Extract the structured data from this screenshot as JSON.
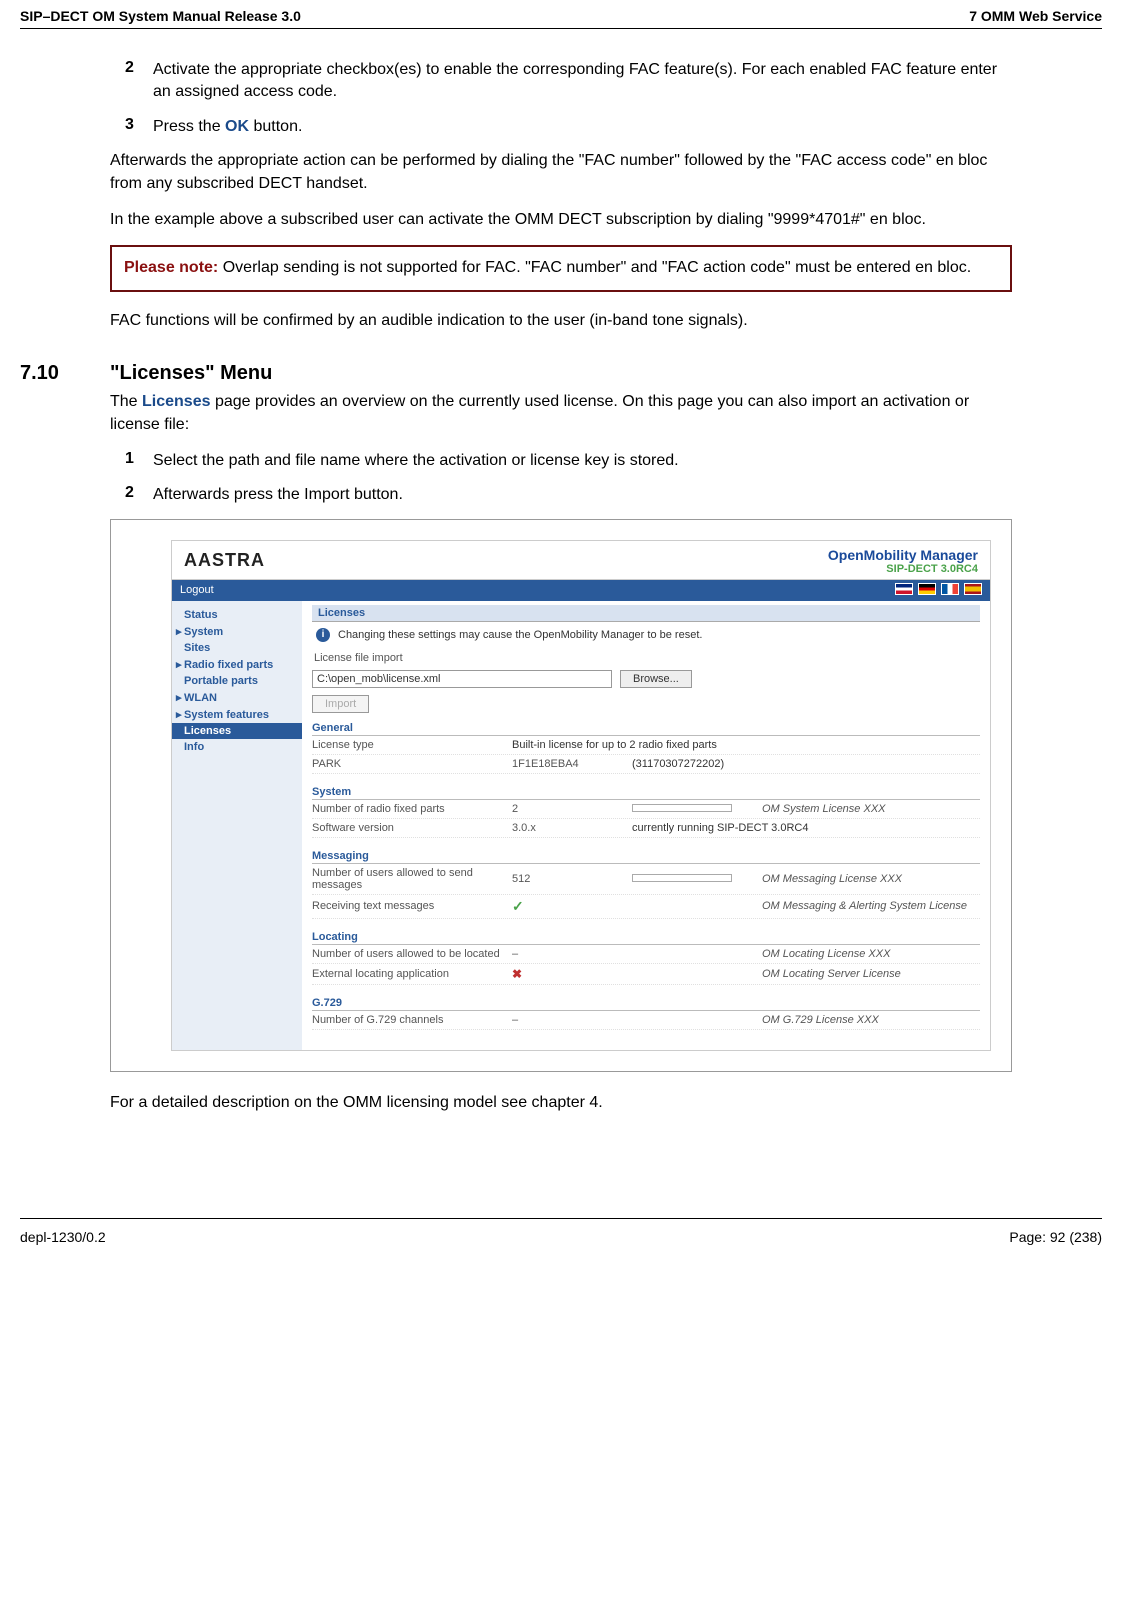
{
  "header": {
    "left": "SIP–DECT OM System Manual Release 3.0",
    "right": "7 OMM Web Service"
  },
  "body": {
    "item2_num": "2",
    "item2": "Activate the appropriate checkbox(es) to enable the corresponding FAC feature(s). For each enabled FAC feature enter an assigned access code.",
    "item3_num": "3",
    "item3_pre": "Press the ",
    "item3_ok": "OK",
    "item3_post": " button.",
    "para_afterwards": "Afterwards the appropriate action can be performed by dialing the \"FAC number\" followed by the \"FAC access code\" en bloc from any subscribed DECT handset.",
    "para_example": "In the example above a subscribed user can activate the OMM DECT subscription by dialing \"9999*4701#\" en bloc.",
    "note_label": "Please note:",
    "note_text": "Overlap sending is not supported for FAC. \"FAC number\" and \"FAC action code\" must be entered en bloc.",
    "para_confirm": "FAC functions will be confirmed by an audible indication to the user (in-band tone signals).",
    "section_num": "7.10",
    "section_title": "\"Licenses\" Menu",
    "licenses_pre": "The ",
    "licenses_link": "Licenses",
    "licenses_post": " page provides an overview on the currently used license. On this page you can also import an activation or license file:",
    "lic_item1_num": "1",
    "lic_item1": "Select the path and file name where the activation or license key is stored.",
    "lic_item2_num": "2",
    "lic_item2": "Afterwards press the Import button.",
    "para_detail": "For a detailed description on the OMM licensing model see chapter 4."
  },
  "screenshot": {
    "logo": "AASTRA",
    "brand_main": "OpenMobility Manager",
    "brand_sub": "SIP-DECT 3.0RC4",
    "logout": "Logout",
    "nav": {
      "status": "Status",
      "system": "System",
      "sites": "Sites",
      "rfp": "Radio fixed parts",
      "pp": "Portable parts",
      "wlan": "WLAN",
      "sf": "System features",
      "licenses": "Licenses",
      "info": "Info"
    },
    "panel_title": "Licenses",
    "info_text": "Changing these settings may cause the OpenMobility Manager to be reset.",
    "file_import_label": "License file import",
    "file_path": "C:\\open_mob\\license.xml",
    "browse": "Browse...",
    "import": "Import",
    "sections": {
      "general": "General",
      "general_rows": {
        "lt_label": "License type",
        "lt_val": "Built-in license for up to 2 radio fixed parts",
        "park_label": "PARK",
        "park_val1": "1F1E18EBA4",
        "park_val2": "(31170307272202)"
      },
      "system": "System",
      "system_rows": {
        "rfp_label": "Number of radio fixed parts",
        "rfp_val": "2",
        "rfp_lic": "OM System License XXX",
        "sw_label": "Software version",
        "sw_val": "3.0.x",
        "sw_note": "currently running SIP-DECT 3.0RC4"
      },
      "messaging": "Messaging",
      "messaging_rows": {
        "send_label": "Number of users allowed to send messages",
        "send_val": "512",
        "send_lic": "OM Messaging License XXX",
        "recv_label": "Receiving text messages",
        "recv_lic": "OM Messaging & Alerting System License"
      },
      "locating": "Locating",
      "locating_rows": {
        "loc_label": "Number of users allowed to be located",
        "loc_val": "–",
        "loc_lic": "OM Locating License XXX",
        "ext_label": "External locating application",
        "ext_lic": "OM Locating Server License"
      },
      "g729": "G.729",
      "g729_rows": {
        "ch_label": "Number of G.729 channels",
        "ch_val": "–",
        "ch_lic": "OM G.729 License XXX"
      }
    }
  },
  "footer": {
    "left": "depl-1230/0.2",
    "right": "Page: 92 (238)"
  }
}
